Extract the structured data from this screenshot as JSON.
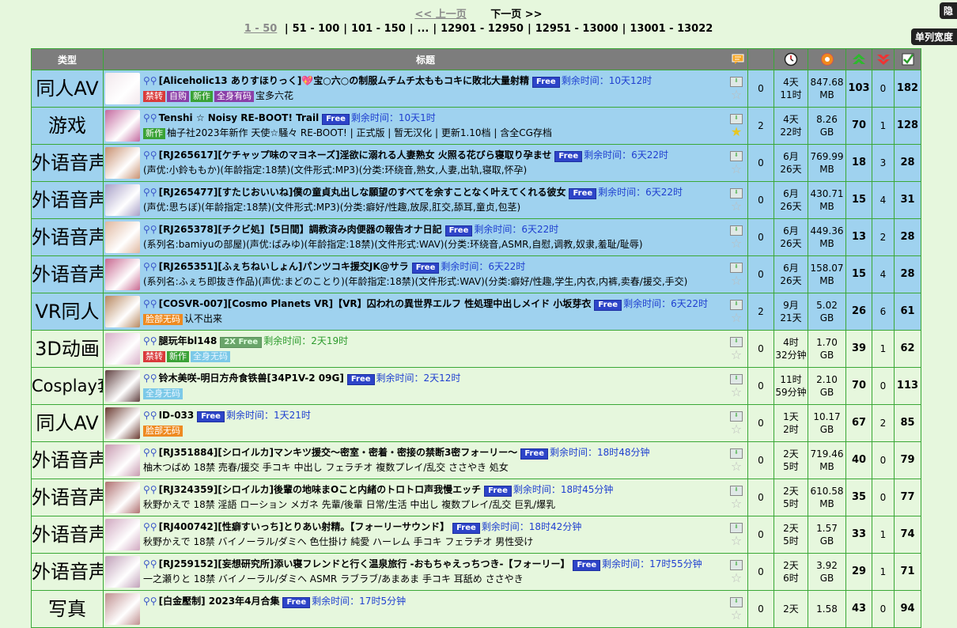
{
  "pagination": {
    "prev_label": "<< 上一页",
    "next_label": "下一页 >>",
    "current": "1 - 50",
    "pages": [
      "51 - 100",
      "101 - 150",
      "...",
      "12901 - 12950",
      "12951 - 13000",
      "13001 - 13022"
    ]
  },
  "side_buttons": {
    "top": "隐",
    "wide": "单列宽度"
  },
  "header": {
    "type": "类型",
    "title": "标题",
    "icons": [
      "comments-icon",
      "clock-icon",
      "size-icon",
      "seeders-icon",
      "leechers-icon",
      "completed-icon"
    ]
  },
  "rows": [
    {
      "type": "同人AV",
      "style": "blue",
      "thumb_color": "#f2e7ec",
      "title": "[Aliceholic13 ありすほりっく]",
      "heart": "💖",
      "title2": "宝○六○の制服ムチムチ太ももコキに敗北大量射精",
      "free": "Free",
      "remain": "剩余时间：10天12时",
      "tags": [
        [
          "禁转",
          "red"
        ],
        [
          "自购",
          "purple"
        ],
        [
          "新作",
          "green"
        ],
        [
          "全身有码",
          "purple"
        ]
      ],
      "sub": "宝多六花",
      "comments": "0",
      "time": [
        "4天",
        "11时"
      ],
      "size": [
        "847.68",
        "MB"
      ],
      "seeders": "103",
      "leechers": "0",
      "done": "182",
      "starred": false
    },
    {
      "type": "游戏",
      "style": "blue",
      "thumb_color": "#c46aa0",
      "title": "Tenshi ☆ Noisy RE-BOOT! Trail",
      "heart": "",
      "title2": "",
      "free": "Free",
      "remain": "剩余时间：10天1时",
      "tags": [
        [
          "新作",
          "green"
        ]
      ],
      "sub": "柚子社2023年新作 天使☆騒々 RE-BOOT! | 正式版 | 暂无汉化 | 更新1.10档 | 含全CG存档",
      "comments": "2",
      "time": [
        "4天",
        "22时"
      ],
      "size": [
        "8.26",
        "GB"
      ],
      "seeders": "70",
      "leechers": "1",
      "done": "128",
      "starred": true
    },
    {
      "type": "外语音声",
      "style": "blue",
      "thumb_color": "#c89070",
      "title": "[RJ265617][ケチャップ味のマヨネーズ]淫欲に溺れる人妻熟女 火照る花びら寝取り孕ませ",
      "heart": "",
      "title2": "",
      "free": "Free",
      "remain": "剩余时间：6天22时",
      "tags": [],
      "sub": "(声优:小鈴ももか)(年龄指定:18禁)(文件形式:MP3)(分类:环绕音,熟女,人妻,出轨,寝取,怀孕)",
      "comments": "0",
      "time": [
        "6月",
        "26天"
      ],
      "size": [
        "769.99",
        "MB"
      ],
      "seeders": "18",
      "leechers": "3",
      "done": "28",
      "starred": false
    },
    {
      "type": "外语音声",
      "style": "blue",
      "thumb_color": "#a8a0c8",
      "title": "[RJ265477][すたじおいいね]僕の童貞丸出しな願望のすべてを余すことなく叶えてくれる彼女",
      "heart": "",
      "title2": "",
      "free": "Free",
      "remain": "剩余时间：6天22时",
      "tags": [],
      "sub": "(声优:思ちぼ)(年龄指定:18禁)(文件形式:MP3)(分类:癖好/性趣,放尿,肛交,舔耳,童贞,包茎)",
      "comments": "0",
      "time": [
        "6月",
        "26天"
      ],
      "size": [
        "430.71",
        "MB"
      ],
      "seeders": "15",
      "leechers": "4",
      "done": "31",
      "starred": false
    },
    {
      "type": "外语音声",
      "style": "blue",
      "thumb_color": "#e0b8a0",
      "title": "[RJ265378][チクビ処]【5日間】調教済み肉便器の報告オナ日記",
      "heart": "",
      "title2": "",
      "free": "Free",
      "remain": "剩余时间：6天22时",
      "tags": [],
      "sub": "(系列名:bamiyuの部屋)(声优:ばみゆ)(年龄指定:18禁)(文件形式:WAV)(分类:环绕音,ASMR,自慰,调教,奴隶,羞耻/耻辱)",
      "comments": "0",
      "time": [
        "6月",
        "26天"
      ],
      "size": [
        "449.36",
        "MB"
      ],
      "seeders": "13",
      "leechers": "2",
      "done": "28",
      "starred": false
    },
    {
      "type": "外语音声",
      "style": "blue",
      "thumb_color": "#c86890",
      "title": "[RJ265351][ふぇちねいしょん]パンツコキ援交JK@サラ",
      "heart": "",
      "title2": "",
      "free": "Free",
      "remain": "剩余时间：6天22时",
      "tags": [],
      "sub": "(系列名:ふぇち即抜き作品)(声优:まどのことり)(年龄指定:18禁)(文件形式:WAV)(分类:癖好/性趣,学生,内衣,内裤,卖春/援交,手交)",
      "comments": "0",
      "time": [
        "6月",
        "26天"
      ],
      "size": [
        "158.07",
        "MB"
      ],
      "seeders": "15",
      "leechers": "4",
      "done": "28",
      "starred": false
    },
    {
      "type": "VR同人",
      "style": "blue",
      "thumb_color": "#b88860",
      "title": "[COSVR-007][Cosmo Planets VR]【VR】囚われの異世界エルフ 性処理中出しメイド 小坂芽衣",
      "heart": "",
      "title2": "",
      "free": "Free",
      "remain": "剩余时间：6天22时",
      "tags": [
        [
          "脸部无码",
          "orange"
        ]
      ],
      "sub": "认不出来",
      "comments": "2",
      "time": [
        "9月",
        "21天"
      ],
      "size": [
        "5.02",
        "GB"
      ],
      "seeders": "26",
      "leechers": "6",
      "done": "61",
      "starred": false
    },
    {
      "type": "3D动画",
      "style": "green",
      "thumb_color": "#d8b0c8",
      "title": "腿玩年bl148",
      "heart": "",
      "title2": "",
      "free": "2X Free",
      "remain": "剩余时间：2天19时",
      "tags": [
        [
          "禁转",
          "red"
        ],
        [
          "新作",
          "green"
        ],
        [
          "全身无码",
          "cyan"
        ]
      ],
      "sub": "",
      "comments": "0",
      "time": [
        "4时",
        "32分钟"
      ],
      "size": [
        "1.70",
        "GB"
      ],
      "seeders": "39",
      "leechers": "1",
      "done": "62",
      "starred": false,
      "grey": true
    },
    {
      "type": "Cosplay套图",
      "style": "green",
      "thumb_color": "#604040",
      "title": "铃木美咲-明日方舟食铁兽[34P1V-2 09G]",
      "heart": "",
      "title2": "",
      "free": "Free",
      "remain": "剩余时间：2天12时",
      "tags": [
        [
          "全身无码",
          "cyan"
        ]
      ],
      "sub": "",
      "comments": "0",
      "time": [
        "11时",
        "59分钟"
      ],
      "size": [
        "2.10",
        "GB"
      ],
      "seeders": "70",
      "leechers": "0",
      "done": "113",
      "starred": false
    },
    {
      "type": "同人AV",
      "style": "green",
      "thumb_color": "#6a3a30",
      "title": "ID-033",
      "heart": "",
      "title2": "",
      "free": "Free",
      "remain": "剩余时间：1天21时",
      "tags": [
        [
          "脸部无码",
          "orange"
        ]
      ],
      "sub": "",
      "comments": "0",
      "time": [
        "1天",
        "2时"
      ],
      "size": [
        "10.17",
        "GB"
      ],
      "seeders": "67",
      "leechers": "2",
      "done": "85",
      "starred": false
    },
    {
      "type": "外语音声",
      "style": "green",
      "thumb_color": "#c89ab0",
      "title": "[RJ351884][シロイルカ]マンキツ援交～密室・密着・密接の禁断3密フォーリー～",
      "heart": "",
      "title2": "",
      "free": "Free",
      "remain": "剩余时间：18时48分钟",
      "tags": [],
      "sub": "柚木つばめ 18禁 売春/援交 手コキ 中出し フェラチオ 複数プレイ/乱交 ささやき 処女",
      "comments": "0",
      "time": [
        "2天",
        "5时"
      ],
      "size": [
        "719.46",
        "MB"
      ],
      "seeders": "40",
      "leechers": "0",
      "done": "79",
      "starred": false
    },
    {
      "type": "外语音声",
      "style": "green",
      "thumb_color": "#b07070",
      "title": "[RJ324359][シロイルカ]後輩の地味まOこと内緒のトロトロ声我慢エッチ",
      "heart": "",
      "title2": "",
      "free": "Free",
      "remain": "剩余时间：18时45分钟",
      "tags": [],
      "sub": "秋野かえで 18禁 淫語 ローション メガネ 先輩/後輩 日常/生活 中出し 複数プレイ/乱交 巨乳/爆乳",
      "comments": "0",
      "time": [
        "2天",
        "5时"
      ],
      "size": [
        "610.58",
        "MB"
      ],
      "seeders": "35",
      "leechers": "0",
      "done": "77",
      "starred": false
    },
    {
      "type": "外语音声",
      "style": "green",
      "thumb_color": "#d0a8c0",
      "title": "[RJ400742][性癖すいっち]とりあい射精。【フォーリーサウンド】",
      "heart": "",
      "title2": "",
      "free": "Free",
      "remain": "剩余时间：18时42分钟",
      "tags": [],
      "sub": "秋野かえで 18禁 バイノーラル/ダミヘ 色仕掛け 純愛 ハーレム 手コキ フェラチオ 男性受け",
      "comments": "0",
      "time": [
        "2天",
        "5时"
      ],
      "size": [
        "1.57",
        "GB"
      ],
      "seeders": "33",
      "leechers": "1",
      "done": "74",
      "starred": false
    },
    {
      "type": "外语音声",
      "style": "green",
      "thumb_color": "#c0a0b8",
      "title": "[RJ259152][妄想研究所]添い寝フレンドと行く温泉旅行 -おもちゃえっちつき-【フォーリー】",
      "heart": "",
      "title2": "",
      "free": "Free",
      "remain": "剩余时间：17时55分钟",
      "tags": [],
      "sub": "一之瀬りと 18禁 バイノーラル/ダミヘ ASMR ラブラブ/あまあま 手コキ 耳舐め ささやき",
      "comments": "0",
      "time": [
        "2天",
        "6时"
      ],
      "size": [
        "3.92",
        "GB"
      ],
      "seeders": "29",
      "leechers": "1",
      "done": "71",
      "starred": false
    },
    {
      "type": "写真",
      "style": "green",
      "thumb_color": "#c09090",
      "title": "[白金壓制] 2023年4月合集",
      "heart": "",
      "title2": "",
      "free": "Free",
      "remain": "剩余时间：17时5分钟",
      "tags": [],
      "sub": "",
      "comments": "0",
      "time": [
        "2天",
        ""
      ],
      "size": [
        "1.58",
        ""
      ],
      "seeders": "43",
      "leechers": "0",
      "done": "94",
      "starred": false
    }
  ]
}
